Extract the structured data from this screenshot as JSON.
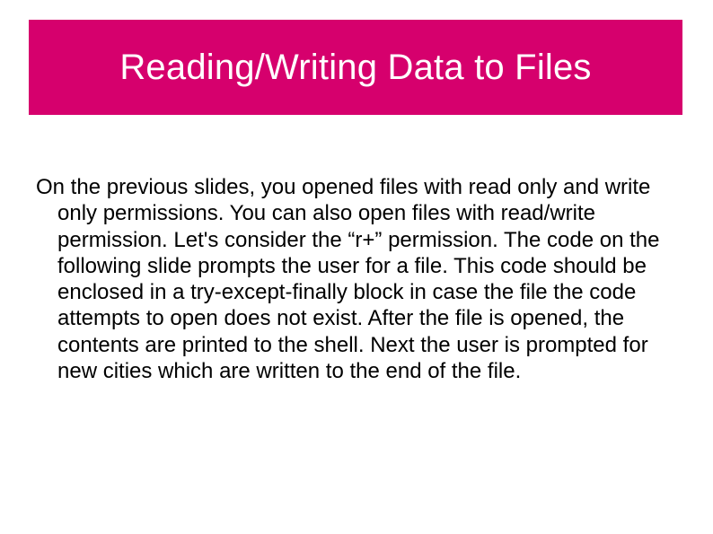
{
  "slide": {
    "title": "Reading/Writing Data to Files",
    "body": "On the previous slides, you opened files with read only and write only permissions.  You can also open files with read/write permission.  Let's consider the “r+” permission.  The code on the following slide prompts the user for a file.  This code should be enclosed in a try-except-finally block in case the file the code attempts to open does not exist.  After the file is opened, the contents are printed to the shell.  Next the user is prompted for new cities which are written to the end of the file."
  }
}
